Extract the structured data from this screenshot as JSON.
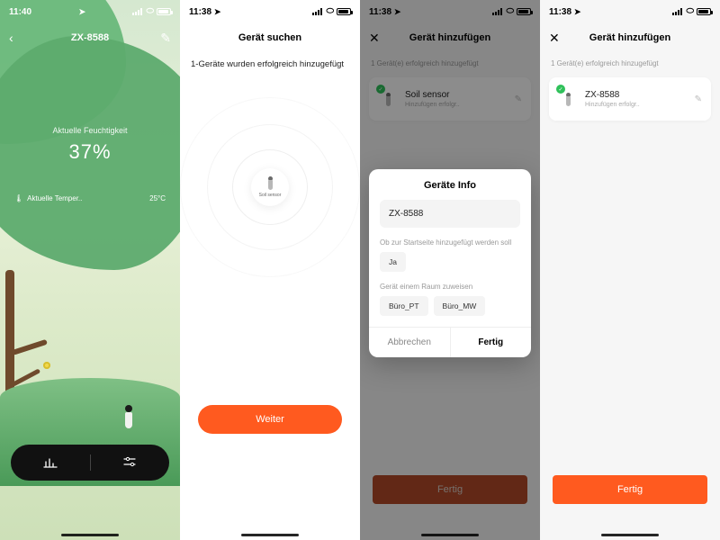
{
  "status": {
    "time": [
      "11:40",
      "11:38",
      "11:38",
      "11:38"
    ]
  },
  "pane1": {
    "title": "ZX-8588",
    "humidity_label": "Aktuelle Feuchtigkeit",
    "humidity_value": "37%",
    "temp_label": "Aktuelle Temper..",
    "temp_value": "25°C"
  },
  "pane2": {
    "title": "Gerät suchen",
    "sub": "1-Geräte wurden erfolgreich hinzugefügt",
    "device_label": "Soil sensor",
    "button": "Weiter"
  },
  "pane3": {
    "title": "Gerät hinzufügen",
    "sub": "1 Gerät(e) erfolgreich hinzugefügt",
    "card_name": "Soil sensor",
    "card_status": "Hinzufügen erfolgr..",
    "button": "Fertig",
    "dialog": {
      "title": "Geräte Info",
      "name_value": "ZX-8588",
      "hp_label": "Ob zur Startseite hinzugefügt werden soll",
      "hp_value": "Ja",
      "room_label": "Gerät einem Raum zuweisen",
      "rooms": [
        "Büro_PT",
        "Büro_MW"
      ],
      "cancel": "Abbrechen",
      "done": "Fertig"
    }
  },
  "pane4": {
    "title": "Gerät hinzufügen",
    "sub": "1 Gerät(e) erfolgreich hinzugefügt",
    "card_name": "ZX-8588",
    "card_status": "Hinzufügen erfolgr..",
    "button": "Fertig"
  }
}
